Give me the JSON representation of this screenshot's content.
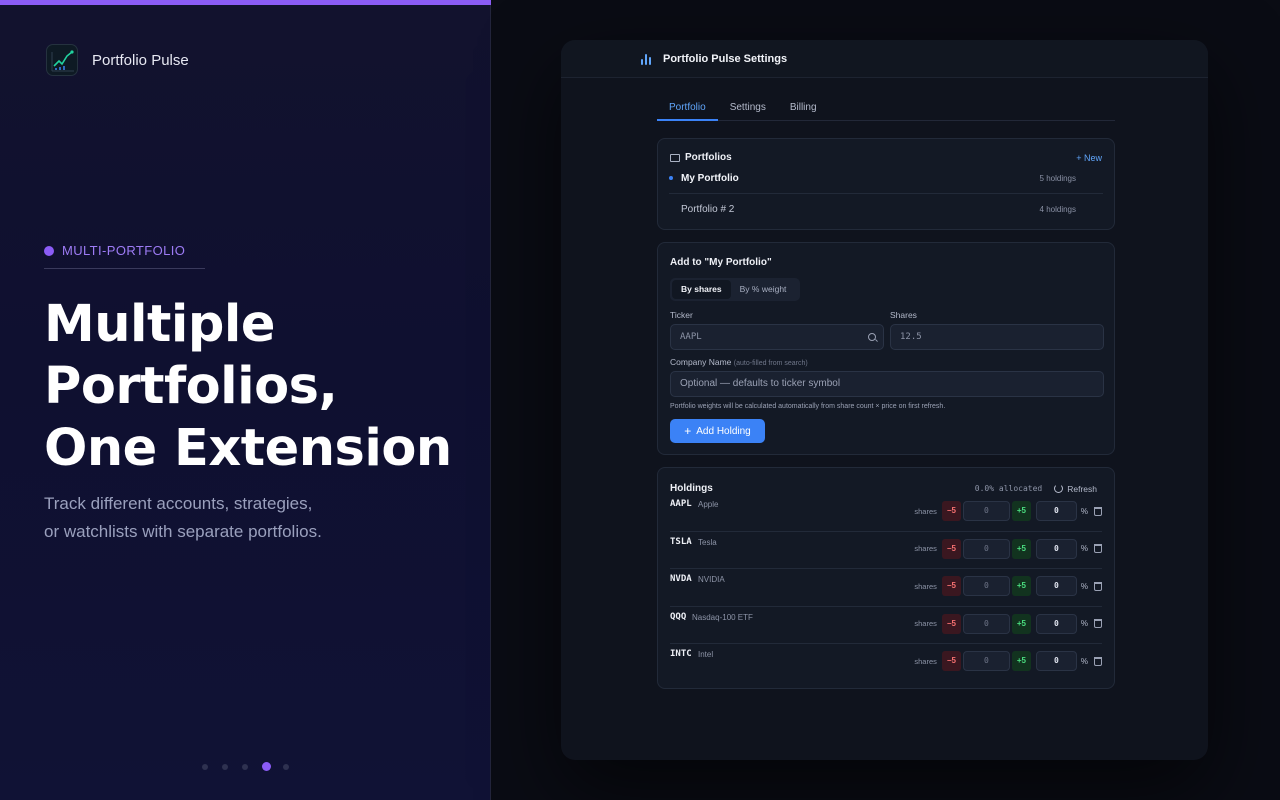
{
  "hero": {
    "brand_name": "Portfolio Pulse",
    "eyebrow": "MULTI-PORTFOLIO",
    "headline": [
      "Multiple",
      "Portfolios,",
      "One Extension"
    ],
    "subtitle": [
      "Track different accounts, strategies,",
      "or watchlists with separate portfolios."
    ],
    "slide_count": 5,
    "active_slide": 4
  },
  "window": {
    "title": "Portfolio Pulse Settings",
    "tabs": [
      {
        "label": "Portfolio",
        "active": true
      },
      {
        "label": "Settings",
        "active": false
      },
      {
        "label": "Billing",
        "active": false
      }
    ]
  },
  "portfolios": {
    "title": "Portfolios",
    "new_label": "+ New",
    "items": [
      {
        "name": "My Portfolio",
        "count": "5 holdings",
        "selected": true
      },
      {
        "name": "Portfolio # 2",
        "count": "4 holdings",
        "selected": false
      }
    ]
  },
  "add_form": {
    "title": "Add to \"My Portfolio\"",
    "mode_shares": "By shares",
    "mode_weight": "By % weight",
    "ticker_label": "Ticker",
    "ticker_placeholder": "AAPL",
    "shares_label": "Shares",
    "shares_placeholder": "12.5",
    "company_label": "Company Name",
    "company_hint": "(auto-filled from search)",
    "company_placeholder": "Optional — defaults to ticker symbol",
    "hint": "Portfolio weights will be calculated automatically from share count × price on first refresh.",
    "add_button": "Add Holding"
  },
  "holdings": {
    "title": "Holdings",
    "allocated": "0.0% allocated",
    "refresh_label": "Refresh",
    "shares_label": "shares",
    "minus_label": "−5",
    "plus_label": "+5",
    "pct_label": "%",
    "rows": [
      {
        "ticker": "AAPL",
        "name": "Apple",
        "shares": "0",
        "weight": "0"
      },
      {
        "ticker": "TSLA",
        "name": "Tesla",
        "shares": "0",
        "weight": "0"
      },
      {
        "ticker": "NVDA",
        "name": "NVIDIA",
        "shares": "0",
        "weight": "0"
      },
      {
        "ticker": "QQQ",
        "name": "Nasdaq-100 ETF",
        "shares": "0",
        "weight": "0"
      },
      {
        "ticker": "INTC",
        "name": "Intel",
        "shares": "0",
        "weight": "0"
      }
    ]
  },
  "colors": {
    "accent_purple": "#8b5cf6",
    "accent_blue": "#3b82f6",
    "minus_red": "#f87171",
    "plus_green": "#4ade80"
  }
}
